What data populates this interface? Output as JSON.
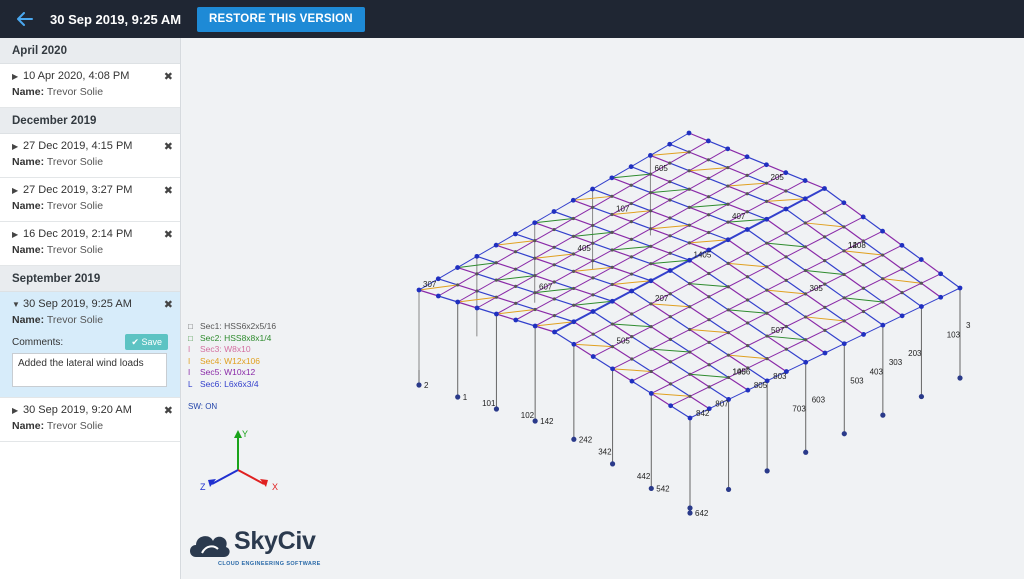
{
  "header": {
    "title": "30 Sep 2019, 9:25 AM",
    "restore_label": "RESTORE THIS VERSION"
  },
  "sidebar": {
    "groups": [
      {
        "label": "April 2020"
      },
      {
        "label": "December 2019"
      },
      {
        "label": "September 2019"
      }
    ],
    "name_prefix": "Name:",
    "versions": [
      {
        "date": "10 Apr 2020, 4:08 PM",
        "name": "Trevor Solie"
      },
      {
        "date": "27 Dec 2019, 4:15 PM",
        "name": "Trevor Solie"
      },
      {
        "date": "27 Dec 2019, 3:27 PM",
        "name": "Trevor Solie"
      },
      {
        "date": "16 Dec 2019, 2:14 PM",
        "name": "Trevor Solie"
      },
      {
        "date": "30 Sep 2019, 9:25 AM",
        "name": "Trevor Solie"
      },
      {
        "date": "30 Sep 2019, 9:20 AM",
        "name": "Trevor Solie"
      }
    ],
    "comments_label": "Comments:",
    "save_label": "Save",
    "comment_value": "Added the lateral wind loads"
  },
  "viewport": {
    "legend": [
      {
        "mark": "□",
        "label": "Sec1: HSS6x2x5/16",
        "color": "#555555"
      },
      {
        "mark": "□",
        "label": "Sec2: HSS8x8x1/4",
        "color": "#2e8b2e"
      },
      {
        "mark": "I",
        "label": "Sec3: W8x10",
        "color": "#d36fa0"
      },
      {
        "mark": "I",
        "label": "Sec4: W12x106",
        "color": "#e0a020"
      },
      {
        "mark": "I",
        "label": "Sec5: W10x12",
        "color": "#8a2aa8"
      },
      {
        "mark": "L",
        "label": "Sec6: L6x6x3/4",
        "color": "#3340cc"
      }
    ],
    "sw_label": "SW: ON",
    "axis_labels": {
      "x": "X",
      "y": "Y",
      "z": "Z"
    },
    "logo_text": "SkyCiv",
    "logo_sub": "CLOUD ENGINEERING SOFTWARE",
    "node_labels": [
      "842",
      "807",
      "805",
      "803",
      "703",
      "603",
      "503",
      "403",
      "303",
      "203",
      "103",
      "3",
      "2",
      "1",
      "101",
      "102",
      "142",
      "242",
      "342",
      "442",
      "542",
      "642",
      "12",
      "105",
      "107",
      "205",
      "207",
      "305",
      "307",
      "405",
      "407",
      "505",
      "507",
      "605",
      "607",
      "1405",
      "1408",
      "1406"
    ]
  }
}
